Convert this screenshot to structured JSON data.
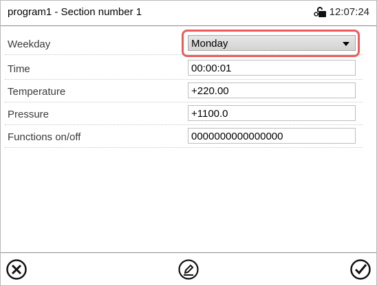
{
  "header": {
    "title": "program1 - Section number 1",
    "time": "12:07:24",
    "lock_icon": "unlock-key-icon"
  },
  "fields": [
    {
      "label": "Weekday",
      "value": "Monday",
      "type": "dropdown"
    },
    {
      "label": "Time",
      "value": "00:00:01",
      "type": "text"
    },
    {
      "label": "Temperature",
      "value": "+220.00",
      "type": "text"
    },
    {
      "label": "Pressure",
      "value": "+1100.0",
      "type": "text"
    },
    {
      "label": "Functions on/off",
      "value": "0000000000000000",
      "type": "text"
    }
  ],
  "footer": {
    "cancel_icon": "close-circle-icon",
    "edit_icon": "edit-pencil-icon",
    "confirm_icon": "check-circle-icon"
  },
  "colors": {
    "highlight": "#ec5b5b",
    "divider": "#8a8a8a"
  }
}
